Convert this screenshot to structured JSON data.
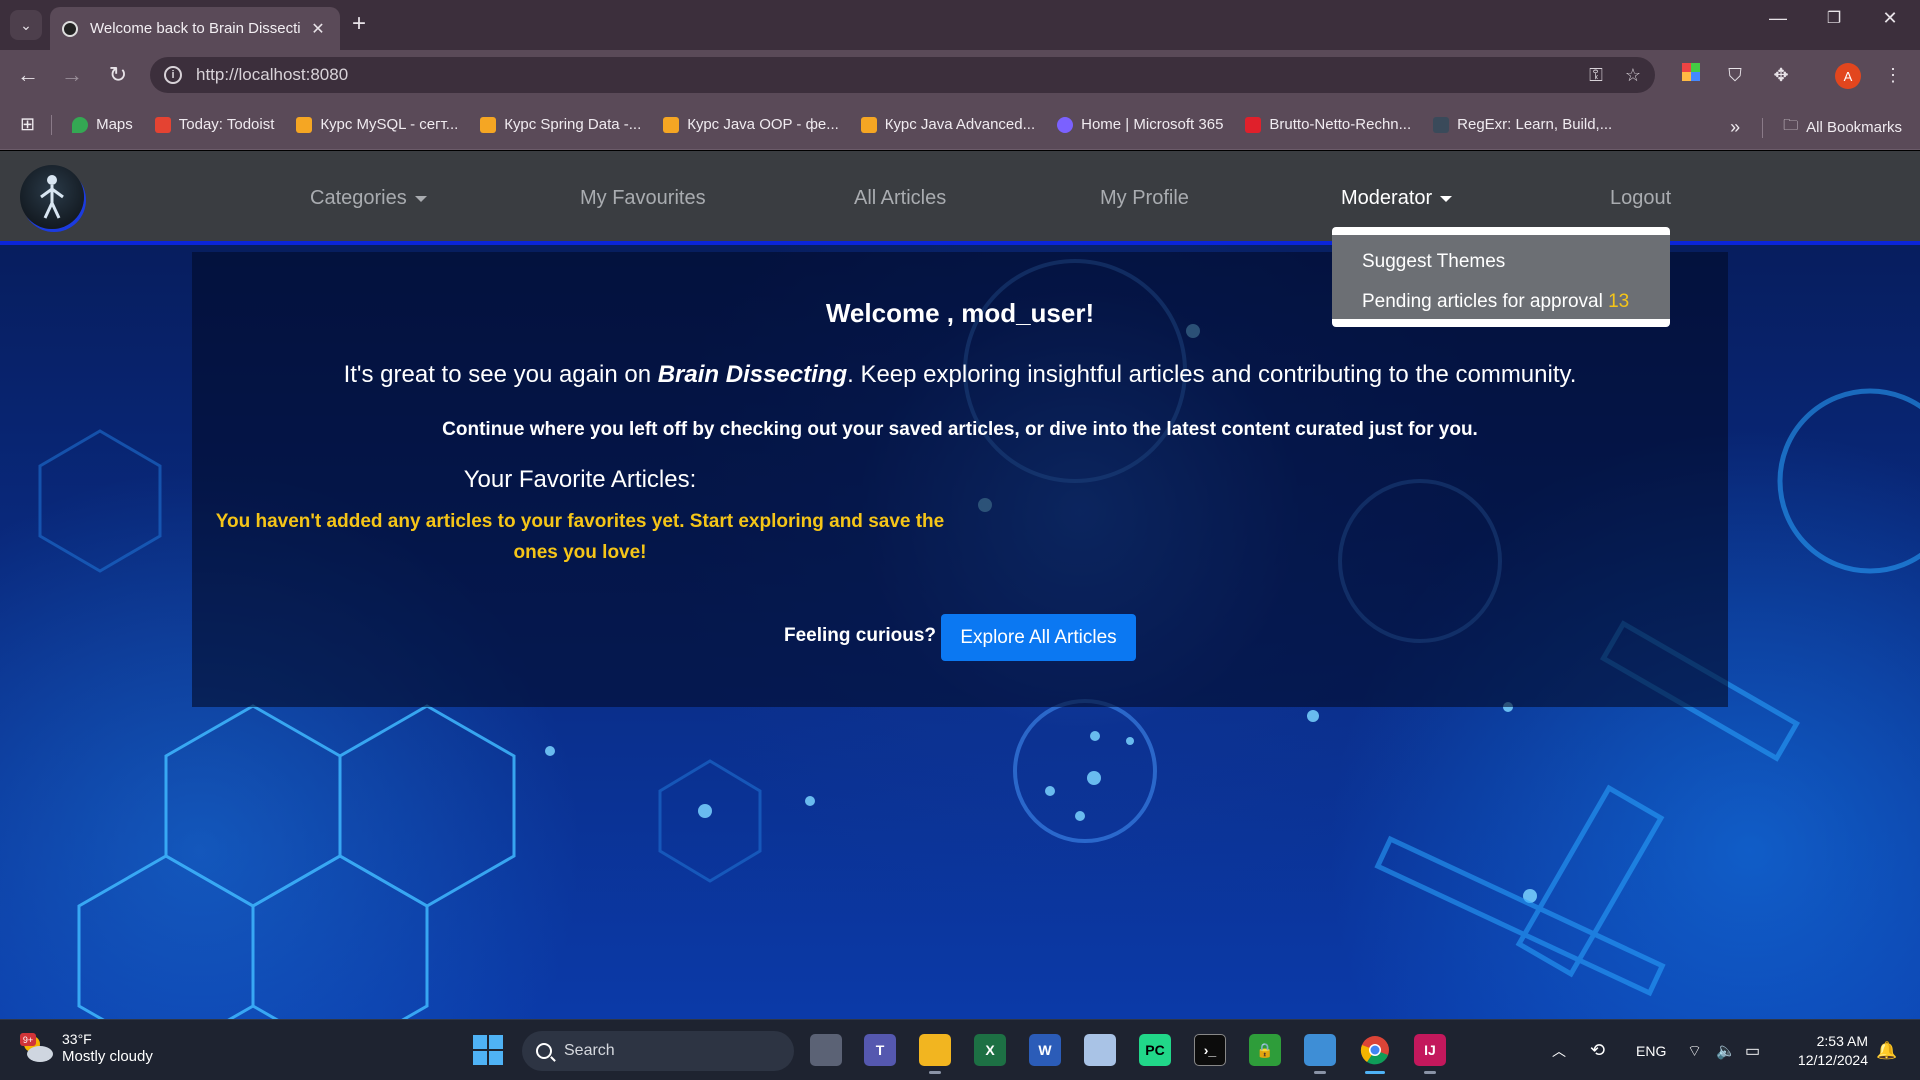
{
  "browser": {
    "tab_title": "Welcome back to Brain Dissecting",
    "tab_title_visible": "Welcome back to Brain Dissecti",
    "url": "http://localhost:8080",
    "profile_initial": "A",
    "bookmarks": [
      {
        "label": "Maps",
        "color": "#34a853"
      },
      {
        "label": "Today: Todoist",
        "color": "#e44332"
      },
      {
        "label": "Курс MySQL - сегт...",
        "color": "#f5a623"
      },
      {
        "label": "Курс Spring Data -...",
        "color": "#f5a623"
      },
      {
        "label": "Курс Java OOP - фе...",
        "color": "#f5a623"
      },
      {
        "label": "Курс Java Advanced...",
        "color": "#f5a623"
      },
      {
        "label": "Home | Microsoft 365",
        "color": "#7b61ff"
      },
      {
        "label": "Brutto-Netto-Rechn...",
        "color": "#e0202b"
      },
      {
        "label": "RegExr: Learn, Build,...",
        "color": "#3a4a5a"
      }
    ],
    "all_bookmarks_label": "All Bookmarks"
  },
  "site": {
    "nav": {
      "categories": "Categories",
      "favourites": "My Favourites",
      "all_articles": "All Articles",
      "profile": "My Profile",
      "moderator": "Moderator",
      "logout": "Logout"
    },
    "moderator_menu": {
      "suggest_themes": "Suggest Themes",
      "pending_label": "Pending articles for approval",
      "pending_count": "13"
    },
    "welcome": "Welcome , mod_user!",
    "intro_before": "It's great to see you again on ",
    "intro_brand": "Brain Dissecting",
    "intro_after": ". Keep exploring insightful articles and contributing to the community.",
    "continue_text": "Continue where you left off by checking out your saved articles, or dive into the latest content curated just for you.",
    "favorites_heading": "Your Favorite Articles:",
    "favorites_empty": "You haven't added any articles to your favorites yet. Start exploring and save the ones you love!",
    "curious_label": "Feeling curious?",
    "explore_button": "Explore All Articles"
  },
  "taskbar": {
    "weather_badge": "9+",
    "temperature": "33°F",
    "condition": "Mostly cloudy",
    "search_placeholder": "Search",
    "language": "ENG",
    "time": "2:53 AM",
    "date": "12/12/2024"
  },
  "colors": {
    "accent_blue": "#0b78f2",
    "nav_underline": "#0a25d9",
    "highlight_yellow": "#f5c518"
  }
}
